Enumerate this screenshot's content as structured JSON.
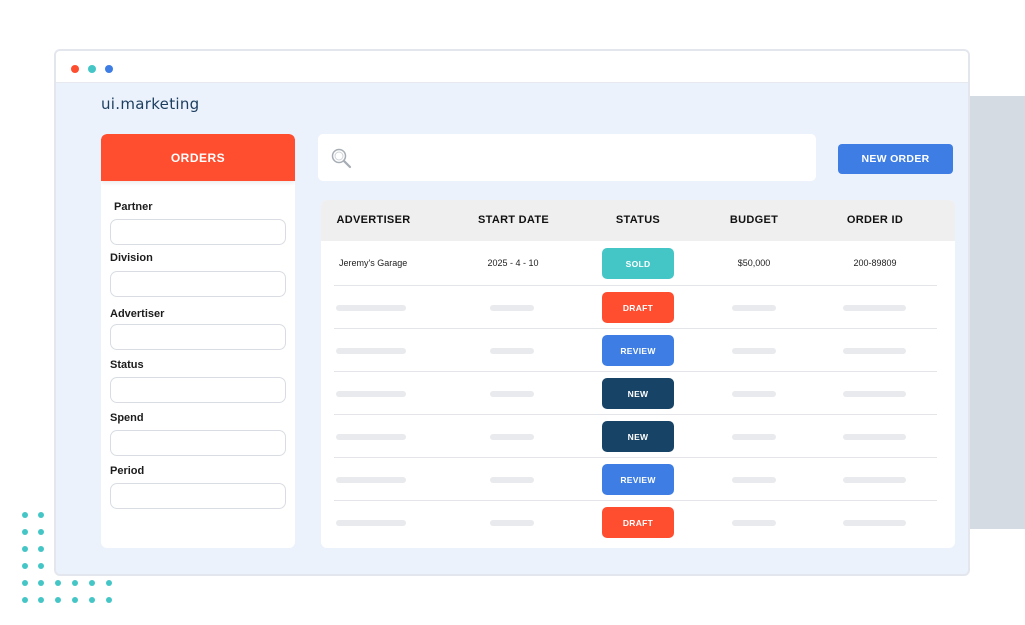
{
  "app": {
    "logo": "ui.marketing"
  },
  "colors": {
    "accent_red": "#fe4d2f",
    "accent_blue": "#3d7de4",
    "teal": "#45c6c6",
    "navy": "#174366",
    "window_bg": "#ebf2fc"
  },
  "window_controls": [
    "close-dot",
    "minimize-dot",
    "maximize-dot"
  ],
  "sidebar": {
    "tab_label": "ORDERS",
    "filters": [
      {
        "label": "Partner",
        "value": ""
      },
      {
        "label": "Division",
        "value": ""
      },
      {
        "label": "Advertiser",
        "value": ""
      },
      {
        "label": "Status",
        "value": ""
      },
      {
        "label": "Spend",
        "value": ""
      },
      {
        "label": "Period",
        "value": ""
      }
    ]
  },
  "search": {
    "icon": "search-icon",
    "value": "",
    "placeholder": ""
  },
  "toolbar": {
    "new_order_label": "NEW ORDER"
  },
  "table": {
    "headers": [
      "ADVERTISER",
      "START DATE",
      "STATUS",
      "BUDGET",
      "ORDER ID"
    ],
    "rows": [
      {
        "advertiser": "Jeremy's Garage",
        "start_date": "2025 - 4 - 10",
        "status": "SOLD",
        "status_color": "#45c6c6",
        "budget": "$50,000",
        "order_id": "200-89809"
      },
      {
        "status": "DRAFT",
        "status_color": "#fe4d2f"
      },
      {
        "status": "REVIEW",
        "status_color": "#3d7de4"
      },
      {
        "status": "NEW",
        "status_color": "#174366"
      },
      {
        "status": "NEW",
        "status_color": "#174366"
      },
      {
        "status": "REVIEW",
        "status_color": "#3d7de4"
      },
      {
        "status": "DRAFT",
        "status_color": "#fe4d2f"
      }
    ]
  }
}
